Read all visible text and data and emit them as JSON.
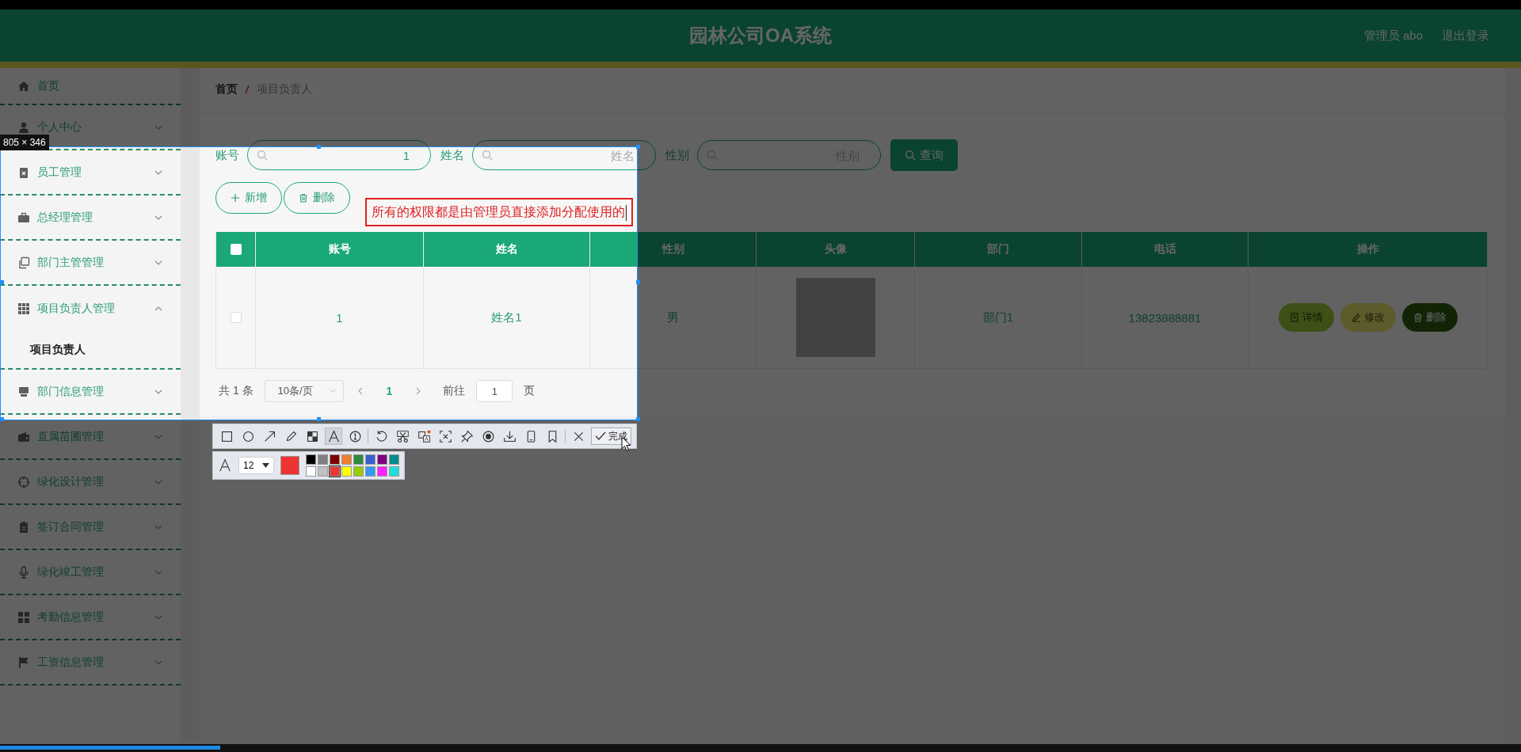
{
  "header": {
    "title": "园林公司OA系统",
    "user": "管理员 abo",
    "logout": "退出登录"
  },
  "sidebar": {
    "items": [
      {
        "label": "首页",
        "kind": "link"
      },
      {
        "label": "个人中心",
        "kind": "menu",
        "expanded": false
      },
      {
        "label": "员工管理",
        "kind": "menu",
        "expanded": false
      },
      {
        "label": "总经理管理",
        "kind": "menu",
        "expanded": false
      },
      {
        "label": "部门主管管理",
        "kind": "menu",
        "expanded": false
      },
      {
        "label": "项目负责人管理",
        "kind": "menu",
        "expanded": true,
        "children": [
          {
            "label": "项目负责人",
            "selected": true
          }
        ]
      },
      {
        "label": "部门信息管理",
        "kind": "menu",
        "expanded": false
      },
      {
        "label": "直属苗圃管理",
        "kind": "menu",
        "expanded": false
      },
      {
        "label": "绿化设计管理",
        "kind": "menu",
        "expanded": false
      },
      {
        "label": "签订合同管理",
        "kind": "menu",
        "expanded": false
      },
      {
        "label": "绿化竣工管理",
        "kind": "menu",
        "expanded": false
      },
      {
        "label": "考勤信息管理",
        "kind": "menu",
        "expanded": false
      },
      {
        "label": "工资信息管理",
        "kind": "menu",
        "expanded": false
      }
    ]
  },
  "breadcrumb": [
    "首页",
    "项目负责人"
  ],
  "search": {
    "fields": [
      {
        "label": "账号",
        "value": "1"
      },
      {
        "label": "姓名",
        "placeholder": "姓名"
      },
      {
        "label": "性别",
        "placeholder": "性别"
      }
    ],
    "button": "查询"
  },
  "actions": [
    {
      "kind": "add",
      "label": "新增"
    },
    {
      "kind": "delete",
      "label": "删除"
    }
  ],
  "table": {
    "all_checked": false,
    "columns": [
      "账号",
      "姓名",
      "性别",
      "头像",
      "部门",
      "电话",
      "操作"
    ],
    "rows": [
      {
        "checked": false,
        "cells": [
          "1",
          "姓名1",
          "男"
        ],
        "department": "部门1",
        "phone": "13823888881",
        "actions": [
          {
            "kind": "detail",
            "label": "详情"
          },
          {
            "kind": "edit",
            "label": "修改"
          },
          {
            "kind": "delete",
            "label": "删除"
          }
        ]
      }
    ]
  },
  "pagination": {
    "total": "共 1 条",
    "page_size": "10条/页",
    "pages": [
      {
        "label": "1",
        "selected": true
      }
    ],
    "goto_label": "前往",
    "goto_value": "1",
    "goto_suffix": "页"
  },
  "screenshot_tool": {
    "size_label": "805 × 346",
    "annotation": "所有的权限都是由管理员直接添加分配使用的",
    "tool_groups": [
      [
        {
          "kind": "rectangle",
          "selected": false
        },
        {
          "kind": "ellipse",
          "selected": false
        },
        {
          "kind": "arrow",
          "selected": false
        },
        {
          "kind": "pencil",
          "selected": false
        },
        {
          "kind": "mosaic",
          "selected": false
        },
        {
          "kind": "text",
          "selected": true
        },
        {
          "kind": "number",
          "selected": false
        }
      ],
      [
        {
          "kind": "undo",
          "selected": false
        },
        {
          "kind": "cut",
          "selected": false
        },
        {
          "kind": "translate",
          "selected": false
        },
        {
          "kind": "ocr",
          "selected": false
        },
        {
          "kind": "pin",
          "selected": false
        },
        {
          "kind": "record",
          "selected": false
        },
        {
          "kind": "download",
          "selected": false
        },
        {
          "kind": "phone",
          "selected": false
        },
        {
          "kind": "bookmark",
          "selected": false
        }
      ],
      [
        {
          "kind": "close",
          "selected": false
        }
      ]
    ],
    "done": "完成",
    "font_size": "12",
    "palette": [
      {
        "color": "#000000",
        "selected": false
      },
      {
        "color": "#808080",
        "selected": false
      },
      {
        "color": "#800000",
        "selected": false
      },
      {
        "color": "#f08030",
        "selected": false
      },
      {
        "color": "#2e8b3a",
        "selected": false
      },
      {
        "color": "#3a5fcd",
        "selected": false
      },
      {
        "color": "#800080",
        "selected": false
      },
      {
        "color": "#008b8b",
        "selected": false
      },
      {
        "color": "#ffffff",
        "selected": false
      },
      {
        "color": "#c0c0c0",
        "selected": false
      },
      {
        "color": "#ee3333",
        "selected": true
      },
      {
        "color": "#ffff00",
        "selected": false
      },
      {
        "color": "#99cc00",
        "selected": false
      },
      {
        "color": "#3399ee",
        "selected": false
      },
      {
        "color": "#ff22ff",
        "selected": false
      },
      {
        "color": "#22dddd",
        "selected": false
      }
    ]
  },
  "video_progress": {
    "level": 0.145
  }
}
